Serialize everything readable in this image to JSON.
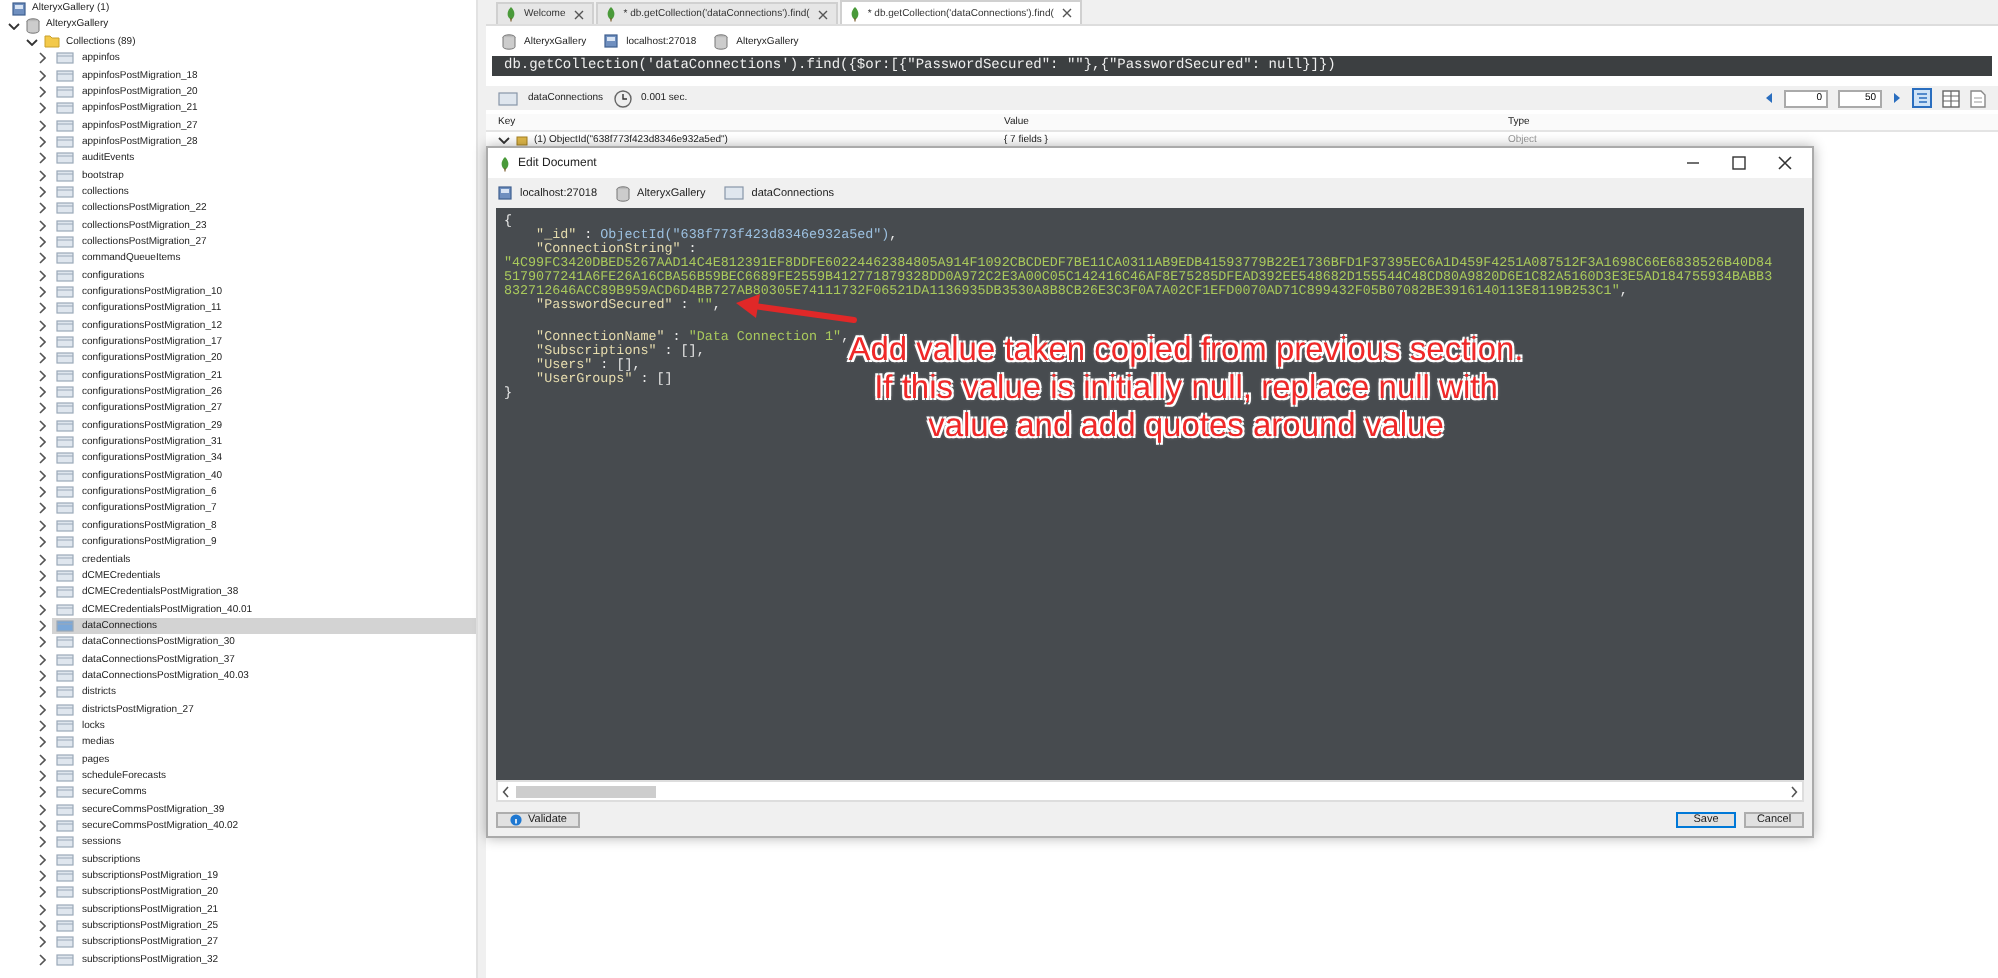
{
  "tree": {
    "server": "AlteryxGallery (1)",
    "database": "AlteryxGallery",
    "database_expanded": true,
    "folder": "Collections (89)",
    "folder_expanded": true,
    "items": [
      {
        "label": "appinfos",
        "selected": false
      },
      {
        "label": "appinfosPostMigration_18",
        "selected": false
      },
      {
        "label": "appinfosPostMigration_20",
        "selected": false
      },
      {
        "label": "appinfosPostMigration_21",
        "selected": false
      },
      {
        "label": "appinfosPostMigration_27",
        "selected": false
      },
      {
        "label": "appinfosPostMigration_28",
        "selected": false
      },
      {
        "label": "auditEvents",
        "selected": false
      },
      {
        "label": "bootstrap",
        "selected": false
      },
      {
        "label": "collections",
        "selected": false
      },
      {
        "label": "collectionsPostMigration_22",
        "selected": false
      },
      {
        "label": "collectionsPostMigration_23",
        "selected": false
      },
      {
        "label": "collectionsPostMigration_27",
        "selected": false
      },
      {
        "label": "commandQueueItems",
        "selected": false
      },
      {
        "label": "configurations",
        "selected": false
      },
      {
        "label": "configurationsPostMigration_10",
        "selected": false
      },
      {
        "label": "configurationsPostMigration_11",
        "selected": false
      },
      {
        "label": "configurationsPostMigration_12",
        "selected": false
      },
      {
        "label": "configurationsPostMigration_17",
        "selected": false
      },
      {
        "label": "configurationsPostMigration_20",
        "selected": false
      },
      {
        "label": "configurationsPostMigration_21",
        "selected": false
      },
      {
        "label": "configurationsPostMigration_26",
        "selected": false
      },
      {
        "label": "configurationsPostMigration_27",
        "selected": false
      },
      {
        "label": "configurationsPostMigration_29",
        "selected": false
      },
      {
        "label": "configurationsPostMigration_31",
        "selected": false
      },
      {
        "label": "configurationsPostMigration_34",
        "selected": false
      },
      {
        "label": "configurationsPostMigration_40",
        "selected": false
      },
      {
        "label": "configurationsPostMigration_6",
        "selected": false
      },
      {
        "label": "configurationsPostMigration_7",
        "selected": false
      },
      {
        "label": "configurationsPostMigration_8",
        "selected": false
      },
      {
        "label": "configurationsPostMigration_9",
        "selected": false
      },
      {
        "label": "credentials",
        "selected": false
      },
      {
        "label": "dCMECredentials",
        "selected": false
      },
      {
        "label": "dCMECredentialsPostMigration_38",
        "selected": false
      },
      {
        "label": "dCMECredentialsPostMigration_40.01",
        "selected": false
      },
      {
        "label": "dataConnections",
        "selected": true
      },
      {
        "label": "dataConnectionsPostMigration_30",
        "selected": false
      },
      {
        "label": "dataConnectionsPostMigration_37",
        "selected": false
      },
      {
        "label": "dataConnectionsPostMigration_40.03",
        "selected": false
      },
      {
        "label": "districts",
        "selected": false
      },
      {
        "label": "districtsPostMigration_27",
        "selected": false
      },
      {
        "label": "locks",
        "selected": false
      },
      {
        "label": "medias",
        "selected": false
      },
      {
        "label": "pages",
        "selected": false
      },
      {
        "label": "scheduleForecasts",
        "selected": false
      },
      {
        "label": "secureComms",
        "selected": false
      },
      {
        "label": "secureCommsPostMigration_39",
        "selected": false
      },
      {
        "label": "secureCommsPostMigration_40.02",
        "selected": false
      },
      {
        "label": "sessions",
        "selected": false
      },
      {
        "label": "subscriptions",
        "selected": false
      },
      {
        "label": "subscriptionsPostMigration_19",
        "selected": false
      },
      {
        "label": "subscriptionsPostMigration_20",
        "selected": false
      },
      {
        "label": "subscriptionsPostMigration_21",
        "selected": false
      },
      {
        "label": "subscriptionsPostMigration_25",
        "selected": false
      },
      {
        "label": "subscriptionsPostMigration_27",
        "selected": false
      },
      {
        "label": "subscriptionsPostMigration_32",
        "selected": false
      }
    ]
  },
  "tabs": [
    {
      "label": "Welcome",
      "selected": false
    },
    {
      "label": "* db.getCollection('dataConnections').find(",
      "selected": false
    },
    {
      "label": "* db.getCollection('dataConnections').find(",
      "selected": true
    }
  ],
  "breadcrumb": [
    {
      "kind": "database",
      "label": "AlteryxGallery"
    },
    {
      "kind": "server",
      "label": "localhost:27018"
    },
    {
      "kind": "database",
      "label": "AlteryxGallery"
    }
  ],
  "query": "db.getCollection('dataConnections').find({$or:[{\"PasswordSecured\": \"\"},{\"PasswordSecured\": null}]})",
  "results": {
    "collection": "dataConnections",
    "time": "0.001 sec.",
    "skip": "0",
    "limit": "50",
    "columns": [
      "Key",
      "Value",
      "Type"
    ],
    "rows": [
      {
        "key": "(1) ObjectId(\"638f773f423d8346e932a5ed\")",
        "value": "{ 7 fields }",
        "type": "Object",
        "expanded": true
      }
    ]
  },
  "dialog": {
    "title": "Edit Document",
    "breadcrumb": [
      {
        "kind": "server",
        "label": "localhost:27018"
      },
      {
        "kind": "database",
        "label": "AlteryxGallery"
      },
      {
        "kind": "collection",
        "label": "dataConnections"
      }
    ],
    "code": [
      [
        {
          "kind": "punct",
          "text": "{"
        }
      ],
      [
        {
          "kind": "key",
          "text": "    \"_id\""
        },
        {
          "kind": "punct",
          "text": " : "
        },
        {
          "kind": "func",
          "text": "ObjectId(\"638f773f423d8346e932a5ed\")"
        },
        {
          "kind": "punct",
          "text": ","
        }
      ],
      [
        {
          "kind": "key",
          "text": "    \"ConnectionString\""
        },
        {
          "kind": "punct",
          "text": " :"
        }
      ],
      [
        {
          "kind": "string",
          "text": "\"4C99FC3420DBED5267AAD14C4E812391EF8DDFE60224462384805A914F1092CBCDEDF7BE11CA0311AB9EDB41593779B22E1736BFD1F37395EC6A1D459F4251A087512F3A1698C66E6838526B40D84"
        }
      ],
      [
        {
          "kind": "string",
          "text": "5179077241A6FE26A16CBA56B59BEC6689FE2559B412771879328DD0A972C2E3A00C05C142416C46AF8E75285DFEAD392EE548682D155544C48CD80A9820D6E1C82A5160D3E3E5AD184755934BABB3"
        }
      ],
      [
        {
          "kind": "string",
          "text": "832712646ACC89B959ACD6D4BB727AB80305E74111732F06521DA1136935DB3530A8B8CB26E3C3F0A7A02CF1EFD0070AD71C899432F05B07082BE3916140113E8119B253C1\""
        },
        {
          "kind": "punct",
          "text": ","
        }
      ],
      [
        {
          "kind": "key",
          "text": "    \"PasswordSecured\""
        },
        {
          "kind": "punct",
          "text": " : "
        },
        {
          "kind": "string",
          "text": "\"\""
        },
        {
          "kind": "punct",
          "text": ","
        }
      ],
      [
        {
          "kind": "key",
          "text": "    \"ConnectionName\""
        },
        {
          "kind": "punct",
          "text": " : "
        },
        {
          "kind": "string",
          "text": "\"Data Connection 1\""
        },
        {
          "kind": "punct",
          "text": ","
        }
      ],
      [
        {
          "kind": "key",
          "text": "    \"Subscriptions\""
        },
        {
          "kind": "punct",
          "text": " : [],"
        }
      ],
      [
        {
          "kind": "key",
          "text": "    \"Users\""
        },
        {
          "kind": "punct",
          "text": " : [],"
        }
      ],
      [
        {
          "kind": "key",
          "text": "    \"UserGroups\""
        },
        {
          "kind": "punct",
          "text": " : []"
        }
      ],
      [
        {
          "kind": "punct",
          "text": "}"
        }
      ]
    ],
    "validate": "Validate",
    "save": "Save",
    "cancel": "Cancel"
  },
  "annotation": "Add value taken copied from previous section. If this value is initially null, replace null with value and add quotes around value"
}
